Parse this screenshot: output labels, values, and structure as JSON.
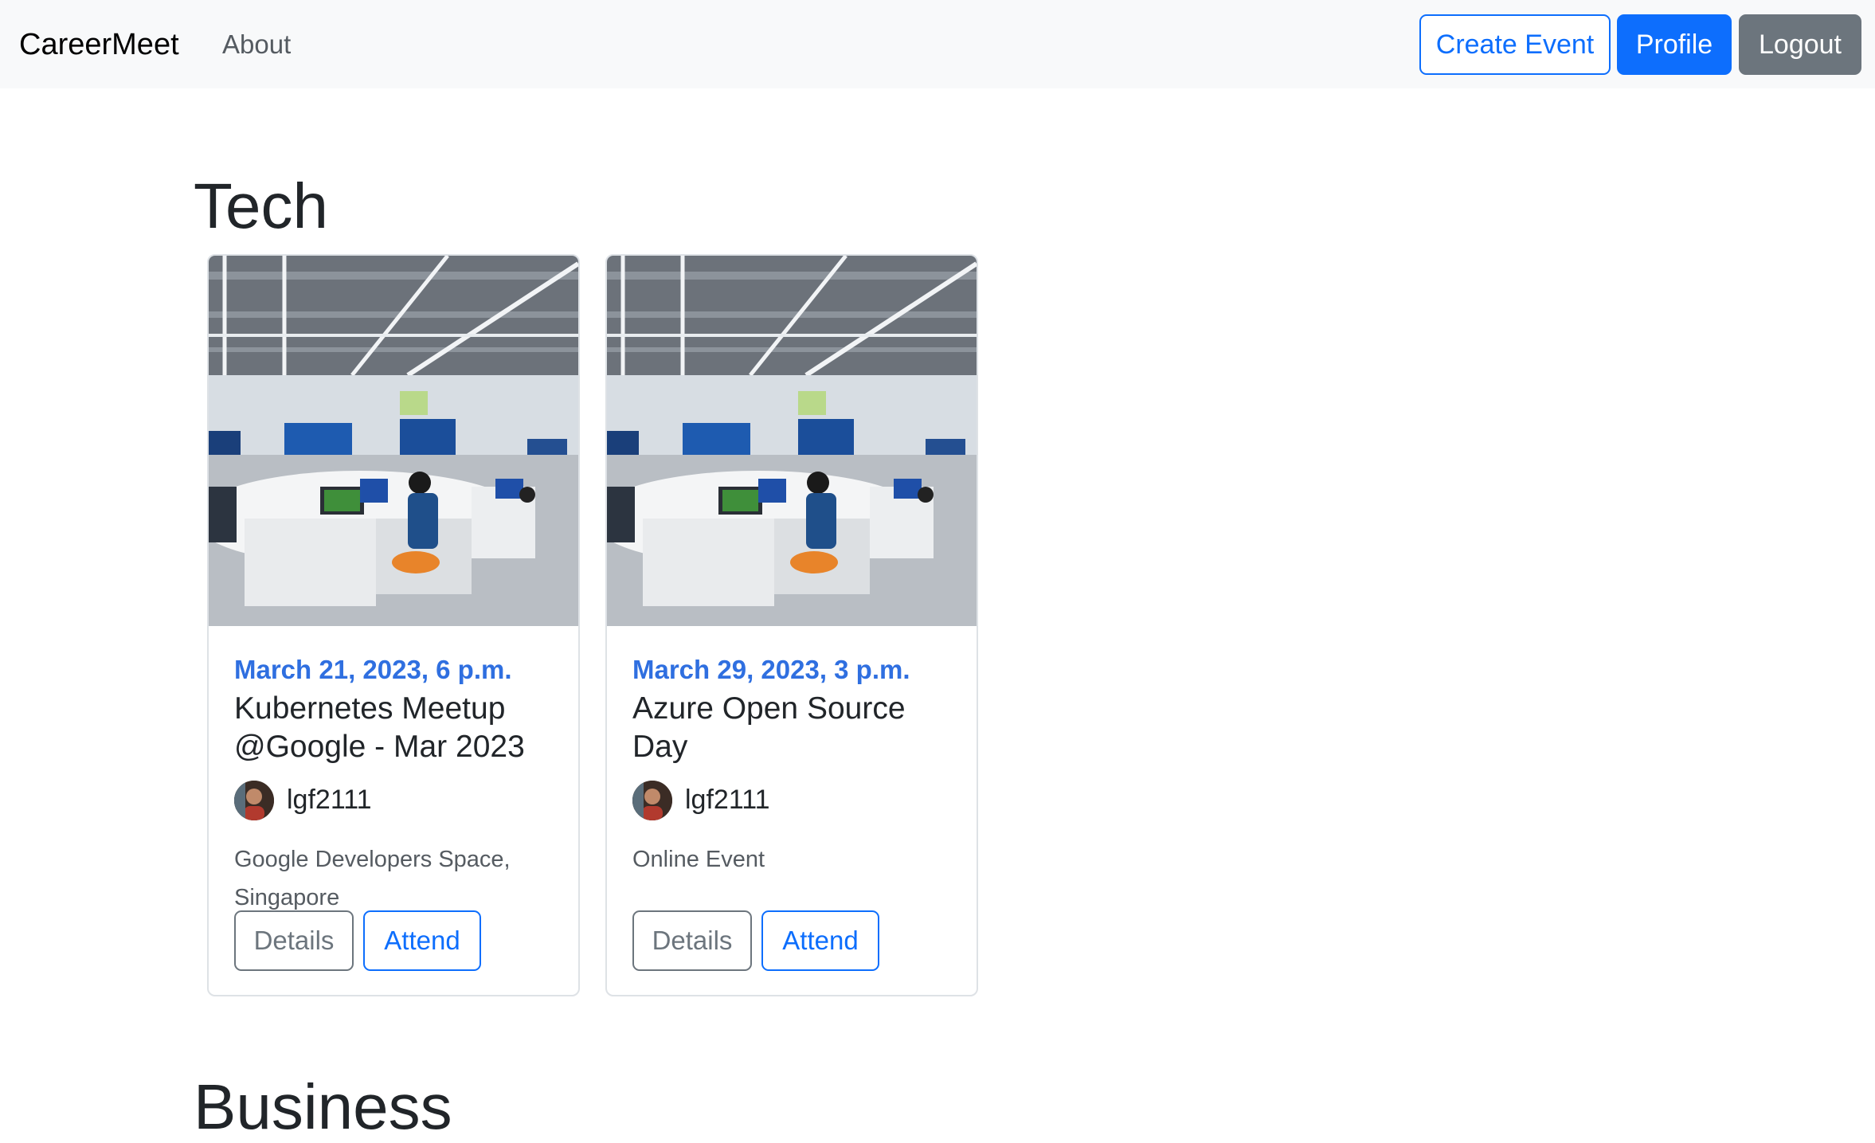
{
  "navbar": {
    "brand": "CareerMeet",
    "about_label": "About",
    "create_event_label": "Create Event",
    "profile_label": "Profile",
    "logout_label": "Logout"
  },
  "sections": [
    {
      "title": "Tech",
      "events": [
        {
          "date": "March 21, 2023, 6 p.m.",
          "title": "Kubernetes Meetup @Google - Mar 2023",
          "organizer": "lgf2111",
          "location": "Google Developers Space, Singapore",
          "details_label": "Details",
          "attend_label": "Attend"
        },
        {
          "date": "March 29, 2023, 3 p.m.",
          "title": "Azure Open Source Day",
          "organizer": "lgf2111",
          "location": "Online Event",
          "details_label": "Details",
          "attend_label": "Attend"
        }
      ]
    },
    {
      "title": "Business",
      "events": []
    }
  ],
  "colors": {
    "primary": "#0d6efd",
    "secondary": "#6c757d",
    "date": "#2f6fe0",
    "navbar_bg": "#f8f9fa"
  },
  "icons": {
    "event_image": "office-workspace-image",
    "organizer_avatar": "user-avatar"
  }
}
